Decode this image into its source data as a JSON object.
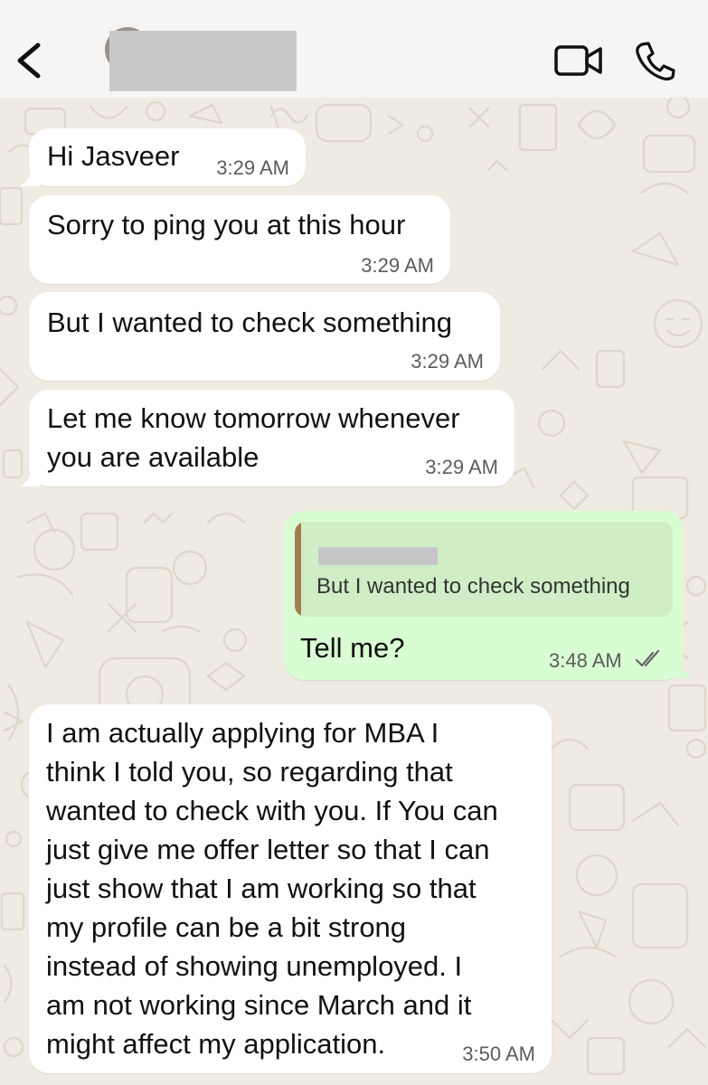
{
  "header": {
    "back_icon": "chevron-left-icon",
    "contact_name": "",
    "video_icon": "video-camera-icon",
    "call_icon": "phone-icon"
  },
  "messages": [
    {
      "direction": "incoming",
      "text": "Hi Jasveer",
      "time": "3:29 AM"
    },
    {
      "direction": "incoming",
      "text": "Sorry to ping you at this hour",
      "time": "3:29 AM"
    },
    {
      "direction": "incoming",
      "text": "But I wanted to check something",
      "time": "3:29 AM"
    },
    {
      "direction": "incoming",
      "lines": [
        "Let me know tomorrow whenever",
        "you are available"
      ],
      "time": "3:29 AM"
    },
    {
      "direction": "outgoing",
      "quoted_text": "But I wanted to check something",
      "text": "Tell me?",
      "time": "3:48 AM",
      "status_icon": "double-check-icon"
    },
    {
      "direction": "incoming",
      "lines": [
        "I am actually applying for MBA I",
        "think I told you, so regarding that",
        "wanted to check with you. If You can",
        "just give me offer letter so that I can",
        "just show that I am working so that",
        "my profile can be a bit strong",
        "instead of showing unemployed. I",
        "am not working since March and it",
        "might affect my application."
      ],
      "time": "3:50 AM"
    }
  ],
  "colors": {
    "background": "#efeae2",
    "incoming_bubble": "#ffffff",
    "outgoing_bubble": "#d9fdd3",
    "quote_bar": "#a47c4e"
  }
}
